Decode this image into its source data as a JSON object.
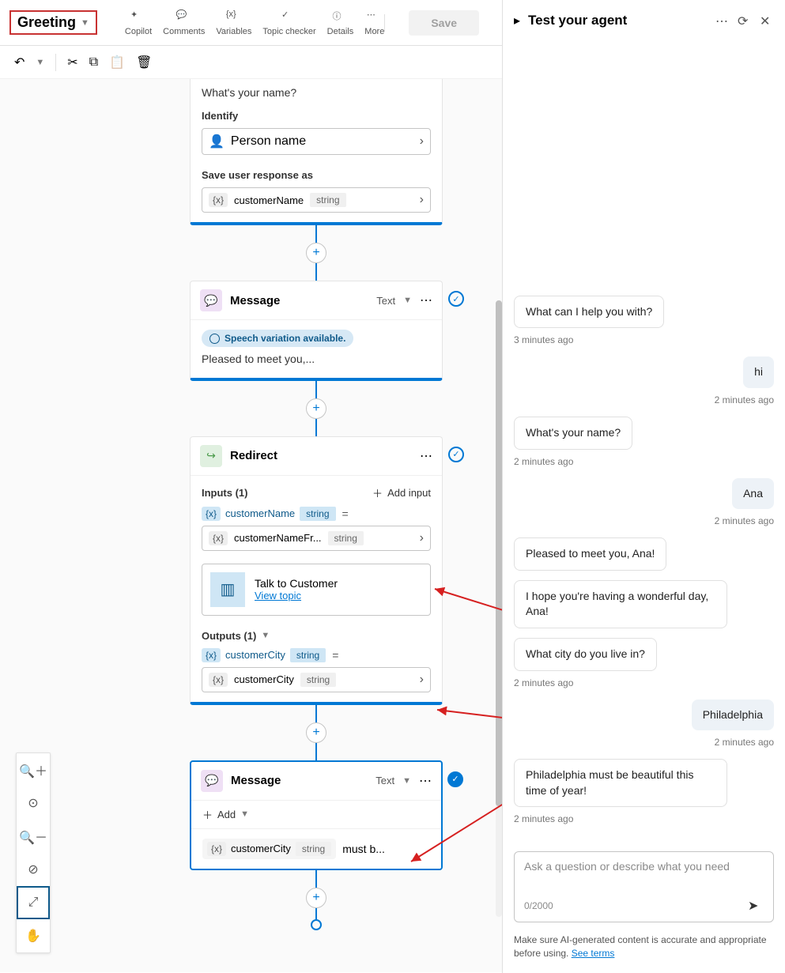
{
  "header": {
    "topic_title": "Greeting",
    "tools": {
      "copilot": "Copilot",
      "comments": "Comments",
      "variables": "Variables",
      "topic_checker": "Topic checker",
      "details": "Details",
      "more": "More"
    },
    "save": "Save"
  },
  "canvas": {
    "question_node": {
      "prompt": "What's your name?",
      "identify_label": "Identify",
      "identify_value": "Person name",
      "save_as_label": "Save user response as",
      "var_name": "customerName",
      "var_type": "string"
    },
    "message_node1": {
      "title": "Message",
      "type_label": "Text",
      "speech_badge": "Speech variation available.",
      "content": "Pleased to meet you,..."
    },
    "redirect_node": {
      "title": "Redirect",
      "inputs_label": "Inputs (1)",
      "add_input": "Add input",
      "input_var": "customerName",
      "input_type": "string",
      "mapped_var": "customerNameFr...",
      "mapped_type": "string",
      "topic_name": "Talk to Customer",
      "view_topic": "View topic",
      "outputs_label": "Outputs (1)",
      "output_var": "customerCity",
      "output_type": "string",
      "output_mapped_var": "customerCity",
      "output_mapped_type": "string"
    },
    "message_node2": {
      "title": "Message",
      "type_label": "Text",
      "add": "Add",
      "var_name": "customerCity",
      "var_type": "string",
      "suffix": "must b..."
    }
  },
  "test_panel": {
    "title": "Test your agent",
    "messages": [
      {
        "side": "bot",
        "text": "What can I help you with?",
        "ts": "3 minutes ago"
      },
      {
        "side": "user",
        "text": "hi",
        "ts": "2 minutes ago"
      },
      {
        "side": "bot",
        "text": "What's your name?",
        "ts": "2 minutes ago"
      },
      {
        "side": "user",
        "text": "Ana",
        "ts": "2 minutes ago"
      },
      {
        "side": "bot",
        "text": "Pleased to meet you, Ana!",
        "ts": ""
      },
      {
        "side": "bot",
        "text": "I hope you're having a wonderful day, Ana!",
        "ts": ""
      },
      {
        "side": "bot",
        "text": "What city do you live in?",
        "ts": "2 minutes ago"
      },
      {
        "side": "user",
        "text": "Philadelphia",
        "ts": "2 minutes ago"
      },
      {
        "side": "bot",
        "text": "Philadelphia must be beautiful this time of year!",
        "ts": "2 minutes ago"
      }
    ],
    "input_placeholder": "Ask a question or describe what you need",
    "counter": "0/2000",
    "disclaimer_pre": "Make sure AI-generated content is accurate and appropriate before using. ",
    "disclaimer_link": "See terms"
  }
}
